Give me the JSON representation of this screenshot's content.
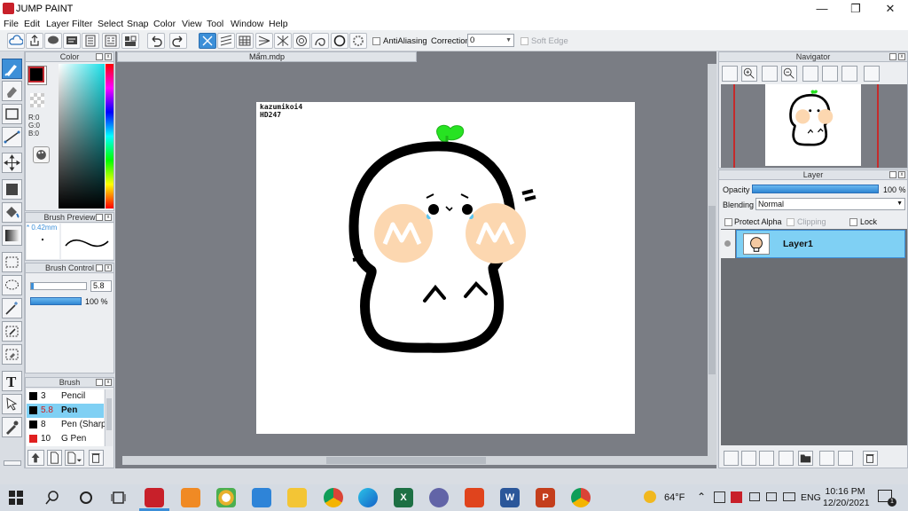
{
  "window": {
    "title": "JUMP PAINT",
    "minimize_icon": "minimize-icon",
    "restore_icon": "restore-icon",
    "close_icon": "close-icon"
  },
  "menu": [
    "File",
    "Edit",
    "Layer",
    "Filter",
    "Select",
    "Snap",
    "Color",
    "View",
    "Tool",
    "Window",
    "Help"
  ],
  "toolbar": {
    "antialiasing_label": "AntiAliasing",
    "correction_label": "Correction",
    "correction_value": "0",
    "soft_edge_label": "Soft Edge"
  },
  "color_panel": {
    "title": "Color",
    "r": "R:0",
    "g": "G:0",
    "b": "B:0",
    "foreground": "#000000"
  },
  "brush_preview": {
    "title": "Brush Preview",
    "size": "* 0.42mm"
  },
  "brush_control": {
    "title": "Brush Control",
    "size_value": "5.8",
    "opacity_value": "100 %"
  },
  "brush_list": {
    "title": "Brush",
    "items": [
      {
        "size": "3",
        "name": "Pencil",
        "selected": false
      },
      {
        "size": "5.8",
        "name": "Pen",
        "selected": true
      },
      {
        "size": "8",
        "name": "Pen (Sharp",
        "selected": false
      },
      {
        "size": "10",
        "name": "G Pen",
        "selected": false
      }
    ]
  },
  "document": {
    "tab_title": "Mẩm.mdp",
    "signature_line1": "kazumikoi4",
    "signature_line2": "HD247"
  },
  "navigator": {
    "title": "Navigator"
  },
  "layer_panel": {
    "title": "Layer",
    "opacity_label": "Opacity",
    "opacity_value": "100 %",
    "blending_label": "Blending",
    "blending_value": "Normal",
    "protect_alpha": "Protect Alpha",
    "clipping": "Clipping",
    "lock": "Lock",
    "layers": [
      {
        "name": "Layer1",
        "selected": true
      }
    ]
  },
  "taskbar": {
    "weather": "64°F",
    "language": "ENG",
    "time": "10:16 PM",
    "date": "12/20/2021",
    "notification_count": "1"
  }
}
